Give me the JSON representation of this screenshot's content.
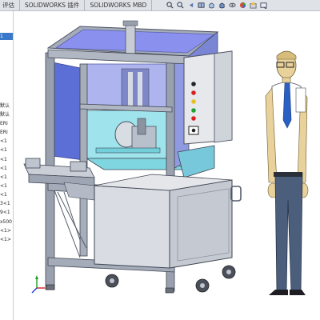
{
  "app": {
    "tabs": [
      "评估",
      "SOLIDWORKS 插件",
      "SOLIDWORKS MBD"
    ]
  },
  "toolbar": {
    "icons": [
      "zoom-fit-icon",
      "zoom-area-icon",
      "previous-view-icon",
      "section-view-icon",
      "view-orientation-icon",
      "display-style-icon",
      "hide-show-icon",
      "edit-appearance-icon",
      "apply-scene-icon",
      "view-settings-icon"
    ]
  },
  "feature_tree": {
    "selected_item": "1",
    "items": [
      "默认",
      "默认",
      "ERI",
      "ERI",
      "<1",
      "<1",
      "<1",
      "<1",
      "<1",
      "<1",
      "<1",
      "3<1",
      "9<1",
      "x500",
      "<1>",
      "<1>"
    ]
  },
  "viewport": {
    "triad_icon": "coordinate-triad-icon",
    "colors": {
      "frame": "#8f97a8",
      "panel_blue": "#5c6fd6",
      "glass_cyan": "#8fe0ea",
      "cabinet": "#d9dce2",
      "skin": "#e8d19a",
      "shirt": "#ffffff",
      "pants": "#4b5f7d"
    }
  }
}
